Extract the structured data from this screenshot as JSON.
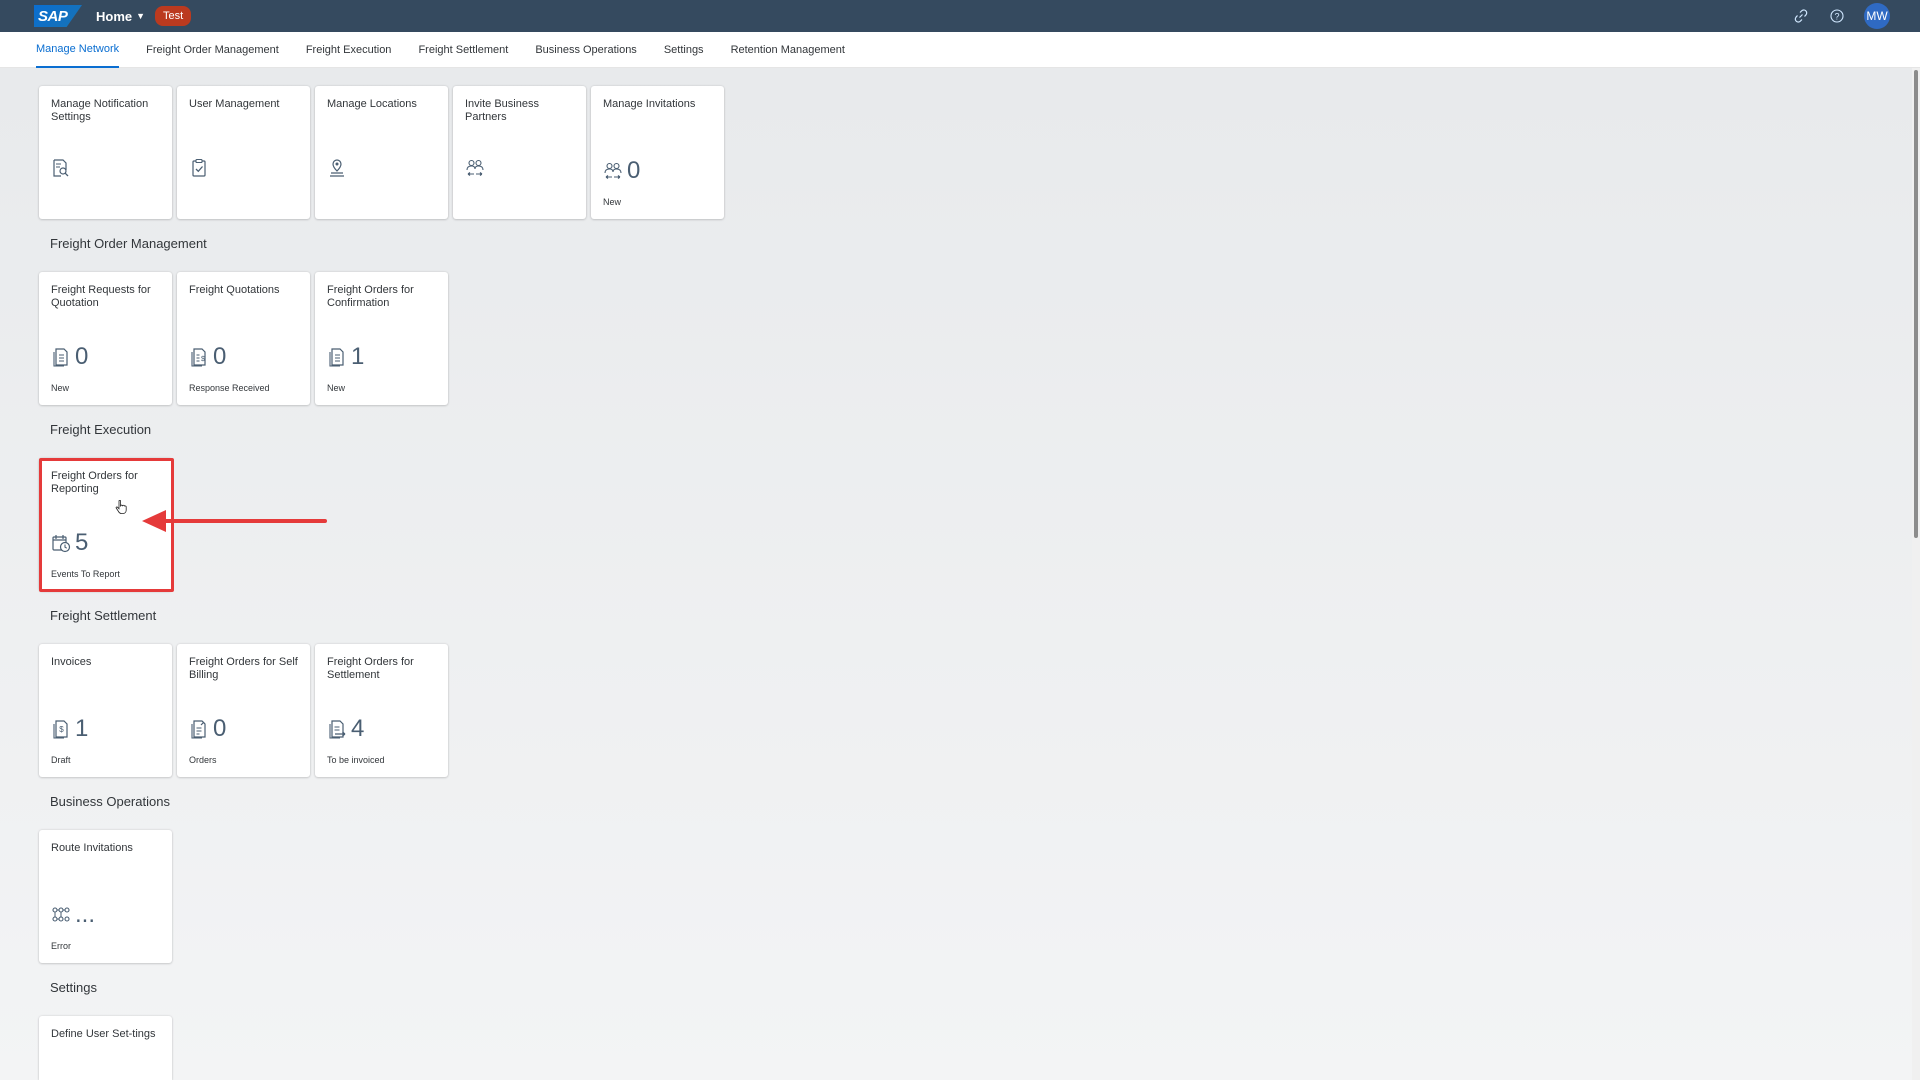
{
  "shell": {
    "logo_text": "SAP",
    "home_label": "Home",
    "env_badge": "Test",
    "avatar_initials": "MW"
  },
  "anchors": [
    {
      "label": "Manage Network"
    },
    {
      "label": "Freight Order Management"
    },
    {
      "label": "Freight Execution"
    },
    {
      "label": "Freight Settlement"
    },
    {
      "label": "Business Operations"
    },
    {
      "label": "Settings"
    },
    {
      "label": "Retention Management"
    }
  ],
  "sections": {
    "manage_network": {
      "tiles": [
        {
          "title": "Manage Notification Settings",
          "icon": "document-search-icon"
        },
        {
          "title": "User Management",
          "icon": "clipboard-check-icon"
        },
        {
          "title": "Manage Locations",
          "icon": "location-pin-icon"
        },
        {
          "title": "Invite Business Partners",
          "icon": "partners-exchange-icon"
        },
        {
          "title": "Manage Invitations",
          "icon": "partners-exchange-icon",
          "number": "0",
          "sub": "New"
        }
      ]
    },
    "freight_order_management": {
      "title": "Freight Order Management",
      "tiles": [
        {
          "title": "Freight Requests for Quotation",
          "icon": "document-list-icon",
          "number": "0",
          "sub": "New"
        },
        {
          "title": "Freight Quotations",
          "icon": "document-dollar-icon",
          "number": "0",
          "sub": "Response Received"
        },
        {
          "title": "Freight Orders for Confirmation",
          "icon": "document-list-icon",
          "number": "1",
          "sub": "New"
        }
      ]
    },
    "freight_execution": {
      "title": "Freight Execution",
      "tiles": [
        {
          "title": "Freight Orders for Reporting",
          "icon": "calendar-clock-icon",
          "number": "5",
          "sub": "Events To Report"
        }
      ]
    },
    "freight_settlement": {
      "title": "Freight Settlement",
      "tiles": [
        {
          "title": "Invoices",
          "icon": "invoice-icon",
          "number": "1",
          "sub": "Draft"
        },
        {
          "title": "Freight Orders for Self Billing",
          "icon": "document-edit-icon",
          "number": "0",
          "sub": "Orders"
        },
        {
          "title": "Freight Orders for Settlement",
          "icon": "document-arrow-icon",
          "number": "4",
          "sub": "To be invoiced"
        }
      ]
    },
    "business_operations": {
      "title": "Business Operations",
      "tiles": [
        {
          "title": "Route Invitations",
          "icon": "network-icon",
          "number": "...",
          "sub": "Error"
        }
      ]
    },
    "settings": {
      "title": "Settings",
      "tiles": [
        {
          "title": "Define User Set-tings"
        }
      ]
    }
  },
  "colors": {
    "shell": "#354a5f",
    "accent": "#0a6ed1",
    "highlight": "#e53a3a",
    "badge": "#bb3a1f"
  }
}
